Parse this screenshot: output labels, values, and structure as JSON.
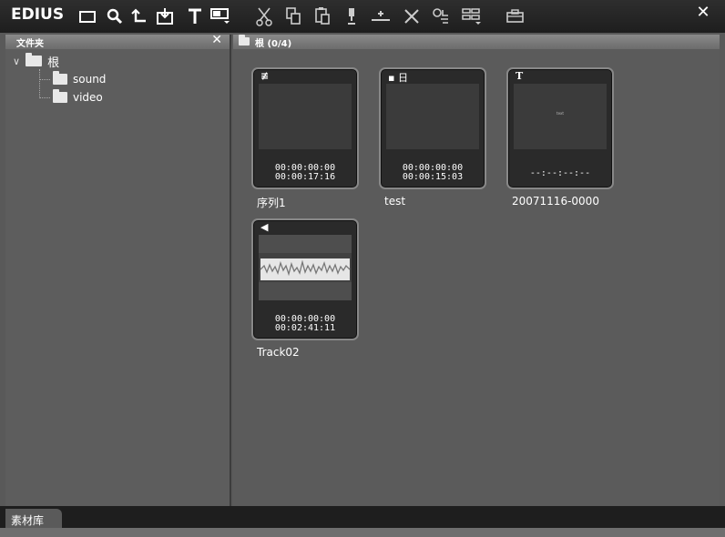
{
  "app": {
    "logo": "EDIUS",
    "close_icon": "close-icon"
  },
  "toolbar": {
    "icons": [
      "new-folder-icon",
      "search-icon",
      "up-icon",
      "import-icon",
      "title-icon",
      "add-to-timeline-icon",
      "cut-icon",
      "copy-icon",
      "paste-icon",
      "add-marker-icon",
      "insert-icon",
      "delete-icon",
      "properties-icon",
      "view-icon",
      "more-icon"
    ]
  },
  "folder_panel": {
    "title": "文件夹",
    "close_label": "✕",
    "root": {
      "label": "根"
    },
    "children": [
      {
        "label": "sound"
      },
      {
        "label": "video"
      }
    ]
  },
  "bin": {
    "header": "根 (0/4)",
    "clips": [
      {
        "name": "序列1",
        "type_icon": "sequence-icon",
        "tc_in": "00:00:00:00",
        "tc_out": "00:00:17:16"
      },
      {
        "name": "test",
        "type_icon": "video-icon",
        "tc_in": "00:00:00:00",
        "tc_out": "00:00:15:03"
      },
      {
        "name": "20071116-0000",
        "type_icon": "title-icon",
        "tc_in": "",
        "tc_out": "--:--:--:--",
        "preview_text": "text"
      },
      {
        "name": "Track02",
        "type_icon": "audio-icon",
        "tc_in": "00:00:00:00",
        "tc_out": "00:02:41:11"
      }
    ]
  },
  "footer": {
    "tab_label": "素材库"
  }
}
